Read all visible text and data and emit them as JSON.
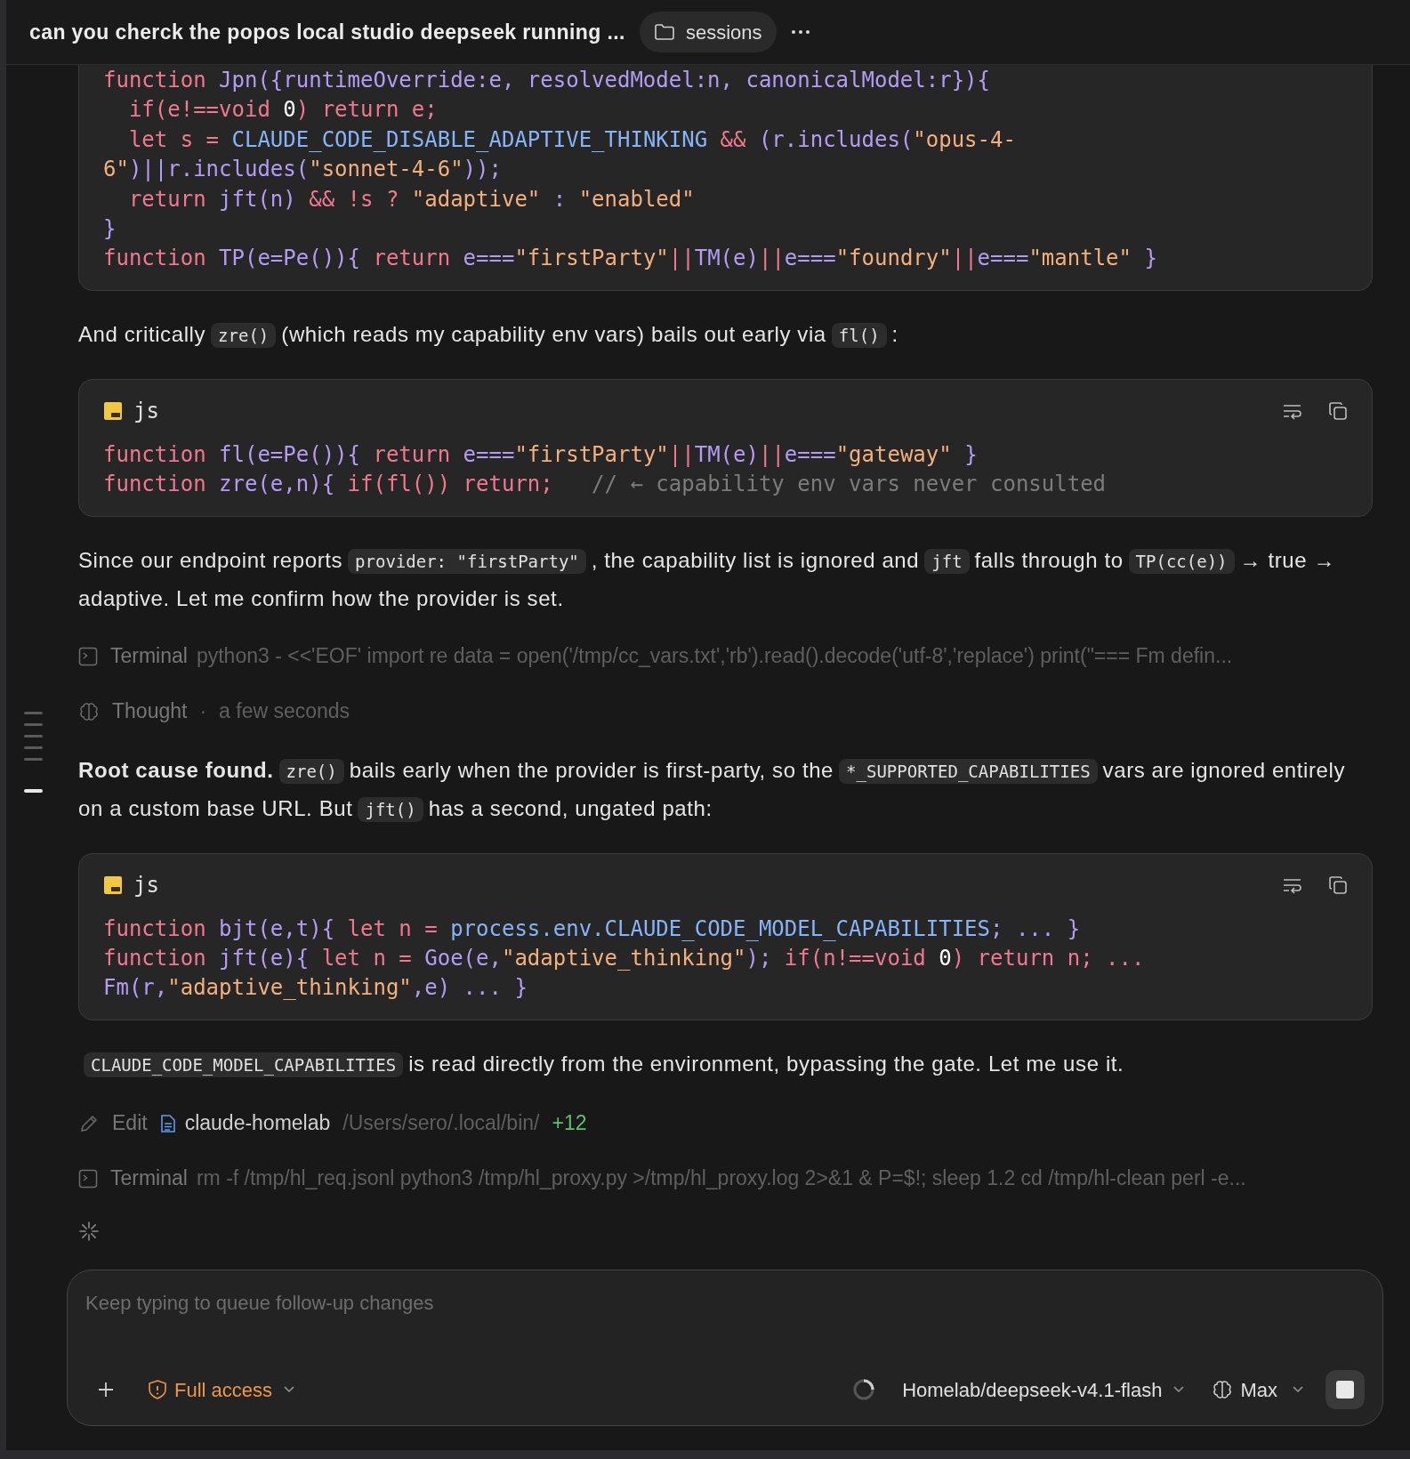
{
  "header": {
    "title": "can you cherck the popos local studio deepseek running ...",
    "sessions_label": "sessions"
  },
  "rail_markers": [
    {
      "selected": false
    },
    {
      "selected": false
    },
    {
      "selected": false
    },
    {
      "selected": false
    },
    {
      "selected": false
    },
    {
      "selected": true
    }
  ],
  "blocks": [
    {
      "kind": "code",
      "lines": [
        [
          {
            "kind": "kw",
            "text": "function "
          },
          {
            "kind": "id",
            "text": "Jpn({runtimeOverride:e, resolvedModel:n, canonicalModel:r}){"
          }
        ],
        [
          {
            "kind": "kw",
            "text": "  if(e!==void "
          },
          {
            "kind": "num",
            "text": "0"
          },
          {
            "kind": "kw",
            "text": ") return e;"
          }
        ],
        [
          {
            "kind": "kw",
            "text": "  let s = "
          },
          {
            "kind": "var",
            "text": "CLAUDE_CODE_DISABLE_ADAPTIVE_THINKING"
          },
          {
            "kind": "kw",
            "text": " && "
          },
          {
            "kind": "id",
            "text": "(r.includes("
          },
          {
            "kind": "str",
            "text": "\"opus-4-"
          }
        ],
        [
          {
            "kind": "str",
            "text": "6\""
          },
          {
            "kind": "id",
            "text": ")||r.includes("
          },
          {
            "kind": "str",
            "text": "\"sonnet-4-6\""
          },
          {
            "kind": "id",
            "text": "));"
          }
        ],
        [
          {
            "kind": "kw",
            "text": "  return "
          },
          {
            "kind": "id",
            "text": "jft(n) "
          },
          {
            "kind": "kw",
            "text": "&& !s ? "
          },
          {
            "kind": "str",
            "text": "\"adaptive\""
          },
          {
            "kind": "id",
            "text": " : "
          },
          {
            "kind": "str",
            "text": "\"enabled\""
          }
        ],
        [
          {
            "kind": "id",
            "text": "}"
          }
        ],
        [
          {
            "kind": "kw",
            "text": "function "
          },
          {
            "kind": "id",
            "text": "TP(e=Pe()){ "
          },
          {
            "kind": "kw",
            "text": "return "
          },
          {
            "kind": "id",
            "text": "e==="
          },
          {
            "kind": "str",
            "text": "\"firstParty\""
          },
          {
            "kind": "kw",
            "text": "||"
          },
          {
            "kind": "id",
            "text": "TM(e)"
          },
          {
            "kind": "kw",
            "text": "||"
          },
          {
            "kind": "id",
            "text": "e==="
          },
          {
            "kind": "str",
            "text": "\"foundry\""
          },
          {
            "kind": "kw",
            "text": "||"
          },
          {
            "kind": "id",
            "text": "e==="
          },
          {
            "kind": "str",
            "text": "\"mantle\""
          },
          {
            "kind": "id",
            "text": " }"
          }
        ]
      ]
    },
    {
      "kind": "paragraph",
      "parts": [
        {
          "kind": "text",
          "text": "And critically"
        },
        {
          "kind": "code",
          "text": "zre()"
        },
        {
          "kind": "text",
          "text": "(which reads my capability env vars) bails out early via"
        },
        {
          "kind": "code",
          "text": "fl()"
        },
        {
          "kind": "text",
          "text": ":"
        }
      ]
    },
    {
      "kind": "code",
      "language": "js",
      "lines": [
        [
          {
            "kind": "kw",
            "text": "function "
          },
          {
            "kind": "id",
            "text": "fl(e=Pe()){ "
          },
          {
            "kind": "kw",
            "text": "return "
          },
          {
            "kind": "id",
            "text": "e==="
          },
          {
            "kind": "str",
            "text": "\"firstParty\""
          },
          {
            "kind": "kw",
            "text": "||"
          },
          {
            "kind": "id",
            "text": "TM(e)"
          },
          {
            "kind": "kw",
            "text": "||"
          },
          {
            "kind": "id",
            "text": "e==="
          },
          {
            "kind": "str",
            "text": "\"gateway\""
          },
          {
            "kind": "id",
            "text": " }"
          }
        ],
        [
          {
            "kind": "kw",
            "text": "function "
          },
          {
            "kind": "id",
            "text": "zre(e,n){ "
          },
          {
            "kind": "kw",
            "text": "if(fl()) return;"
          },
          {
            "kind": "com",
            "text": "   // ← capability env vars never consulted"
          }
        ]
      ]
    },
    {
      "kind": "paragraph",
      "parts": [
        {
          "kind": "text",
          "text": "Since our endpoint reports"
        },
        {
          "kind": "code",
          "text": "provider: \"firstParty\""
        },
        {
          "kind": "text",
          "text": ", the capability list is ignored and"
        },
        {
          "kind": "code",
          "text": "jft"
        },
        {
          "kind": "text",
          "text": "falls through to"
        },
        {
          "kind": "code",
          "text": "TP(cc(e))"
        },
        {
          "kind": "text",
          "text": "→ true → adaptive. Let me confirm how the provider is set."
        }
      ]
    },
    {
      "kind": "terminal",
      "label": "Terminal",
      "command": "python3 - <<'EOF' import re data = open('/tmp/cc_vars.txt','rb').read().decode('utf-8','replace') print(\"=== Fm defin..."
    },
    {
      "kind": "thought",
      "label": "Thought",
      "separator": "·",
      "duration": "a few seconds"
    },
    {
      "kind": "paragraph",
      "parts": [
        {
          "kind": "text",
          "text": "**Root cause found.**"
        },
        {
          "kind": "code",
          "text": "zre()"
        },
        {
          "kind": "text",
          "text": "bails early when the provider is first-party, so the"
        },
        {
          "kind": "code",
          "text": "*_SUPPORTED_CAPABILITIES"
        },
        {
          "kind": "text",
          "text": "vars are ignored entirely on a custom base URL. But"
        },
        {
          "kind": "code",
          "text": "jft()"
        },
        {
          "kind": "text",
          "text": "has a second, ungated path:"
        }
      ]
    },
    {
      "kind": "code",
      "language": "js",
      "lines": [
        [
          {
            "kind": "kw",
            "text": "function "
          },
          {
            "kind": "id",
            "text": "bjt(e,t){ "
          },
          {
            "kind": "kw",
            "text": "let n = "
          },
          {
            "kind": "var",
            "text": "process.env.CLAUDE_CODE_MODEL_CAPABILITIES"
          },
          {
            "kind": "id",
            "text": "; ... }"
          }
        ],
        [
          {
            "kind": "kw",
            "text": "function "
          },
          {
            "kind": "id",
            "text": "jft(e){ "
          },
          {
            "kind": "kw",
            "text": "let n = "
          },
          {
            "kind": "id",
            "text": "Goe(e,"
          },
          {
            "kind": "str",
            "text": "\"adaptive_thinking\""
          },
          {
            "kind": "id",
            "text": "); "
          },
          {
            "kind": "kw",
            "text": "if(n!==void "
          },
          {
            "kind": "num",
            "text": "0"
          },
          {
            "kind": "kw",
            "text": ") return n; ..."
          }
        ],
        [
          {
            "kind": "id",
            "text": "Fm(r,"
          },
          {
            "kind": "str",
            "text": "\"adaptive_thinking\""
          },
          {
            "kind": "id",
            "text": ",e) ... }"
          }
        ]
      ]
    },
    {
      "kind": "paragraph",
      "parts": [
        {
          "kind": "code",
          "text": "CLAUDE_CODE_MODEL_CAPABILITIES"
        },
        {
          "kind": "text",
          "text": "is read directly from the environment, bypassing the gate. Let me use it."
        }
      ]
    },
    {
      "kind": "edit",
      "label": "Edit",
      "file": "claude-homelab",
      "path": "/Users/sero/.local/bin/",
      "diff": "+12"
    },
    {
      "kind": "terminal",
      "label": "Terminal",
      "command": "rm -f /tmp/hl_req.jsonl python3 /tmp/hl_proxy.py >/tmp/hl_proxy.log 2>&1 & P=$!; sleep 1.2 cd /tmp/hl-clean perl -e..."
    },
    {
      "kind": "spinner"
    }
  ],
  "composer": {
    "placeholder": "Keep typing to queue follow-up changes",
    "access": "Full access",
    "model": "Homelab/deepseek-v4.1-flash",
    "effort": "Max"
  }
}
